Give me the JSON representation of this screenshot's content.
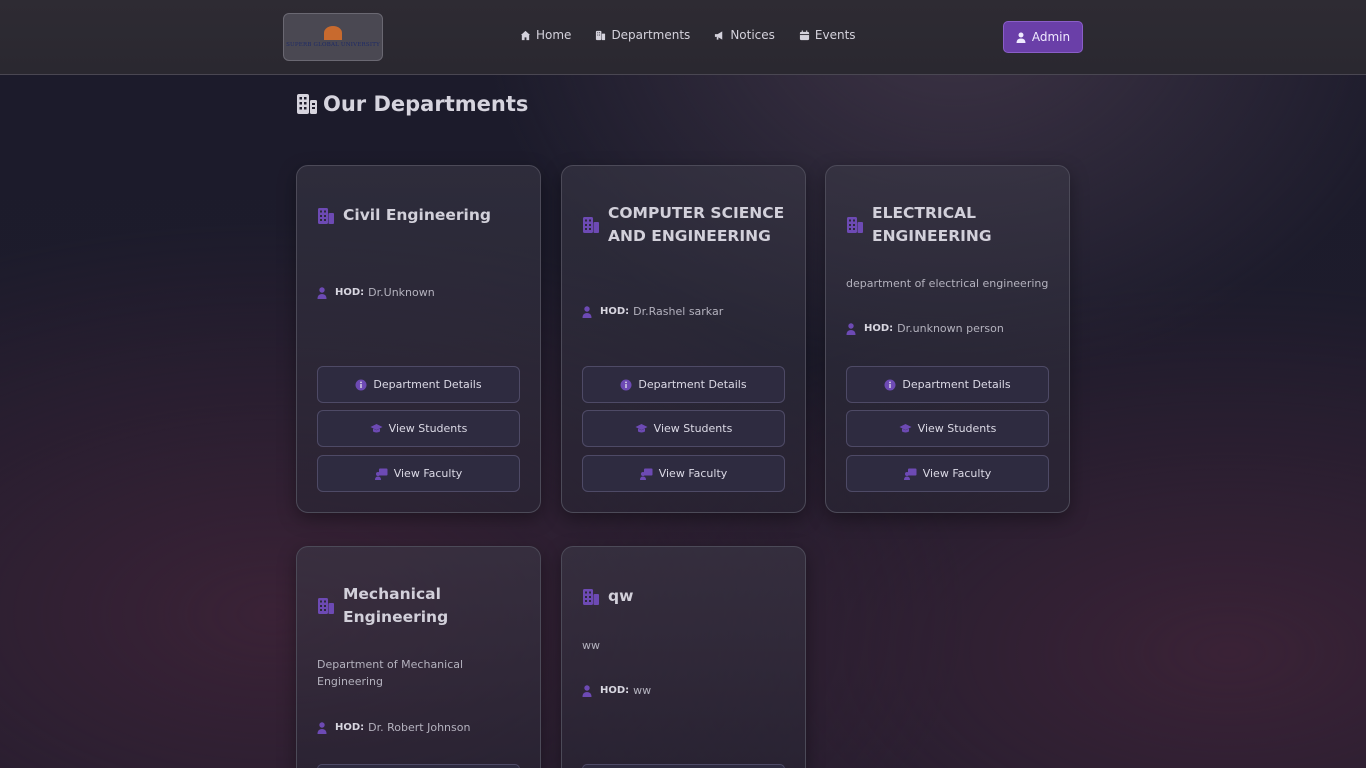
{
  "navbar": {
    "logo_text": "SUPERB GLOBAL UNIVERSITY",
    "links": [
      {
        "label": "Home",
        "icon": "home-icon"
      },
      {
        "label": "Departments",
        "icon": "building-icon"
      },
      {
        "label": "Notices",
        "icon": "megaphone-icon"
      },
      {
        "label": "Events",
        "icon": "calendar-icon"
      }
    ],
    "admin_label": "Admin"
  },
  "page": {
    "title": "Our Departments"
  },
  "hod_label": "HOD:",
  "buttons": {
    "details": "Department Details",
    "students": "View Students",
    "faculty": "View Faculty"
  },
  "departments": [
    {
      "name": "Civil Engineering",
      "description": "",
      "hod": "Dr.Unknown"
    },
    {
      "name": "COMPUTER SCIENCE AND ENGINEERING",
      "description": "",
      "hod": "Dr.Rashel sarkar"
    },
    {
      "name": "ELECTRICAL ENGINEERING",
      "description": "department of electrical engineering",
      "hod": "Dr.unknown person"
    },
    {
      "name": "Mechanical Engineering",
      "description": "Department of Mechanical Engineering",
      "hod": "Dr. Robert Johnson"
    },
    {
      "name": "qw",
      "description": "ww",
      "hod": "ww"
    }
  ],
  "colors": {
    "accent": "#6a3fa8",
    "icon_purple": "#6d4ab4"
  }
}
